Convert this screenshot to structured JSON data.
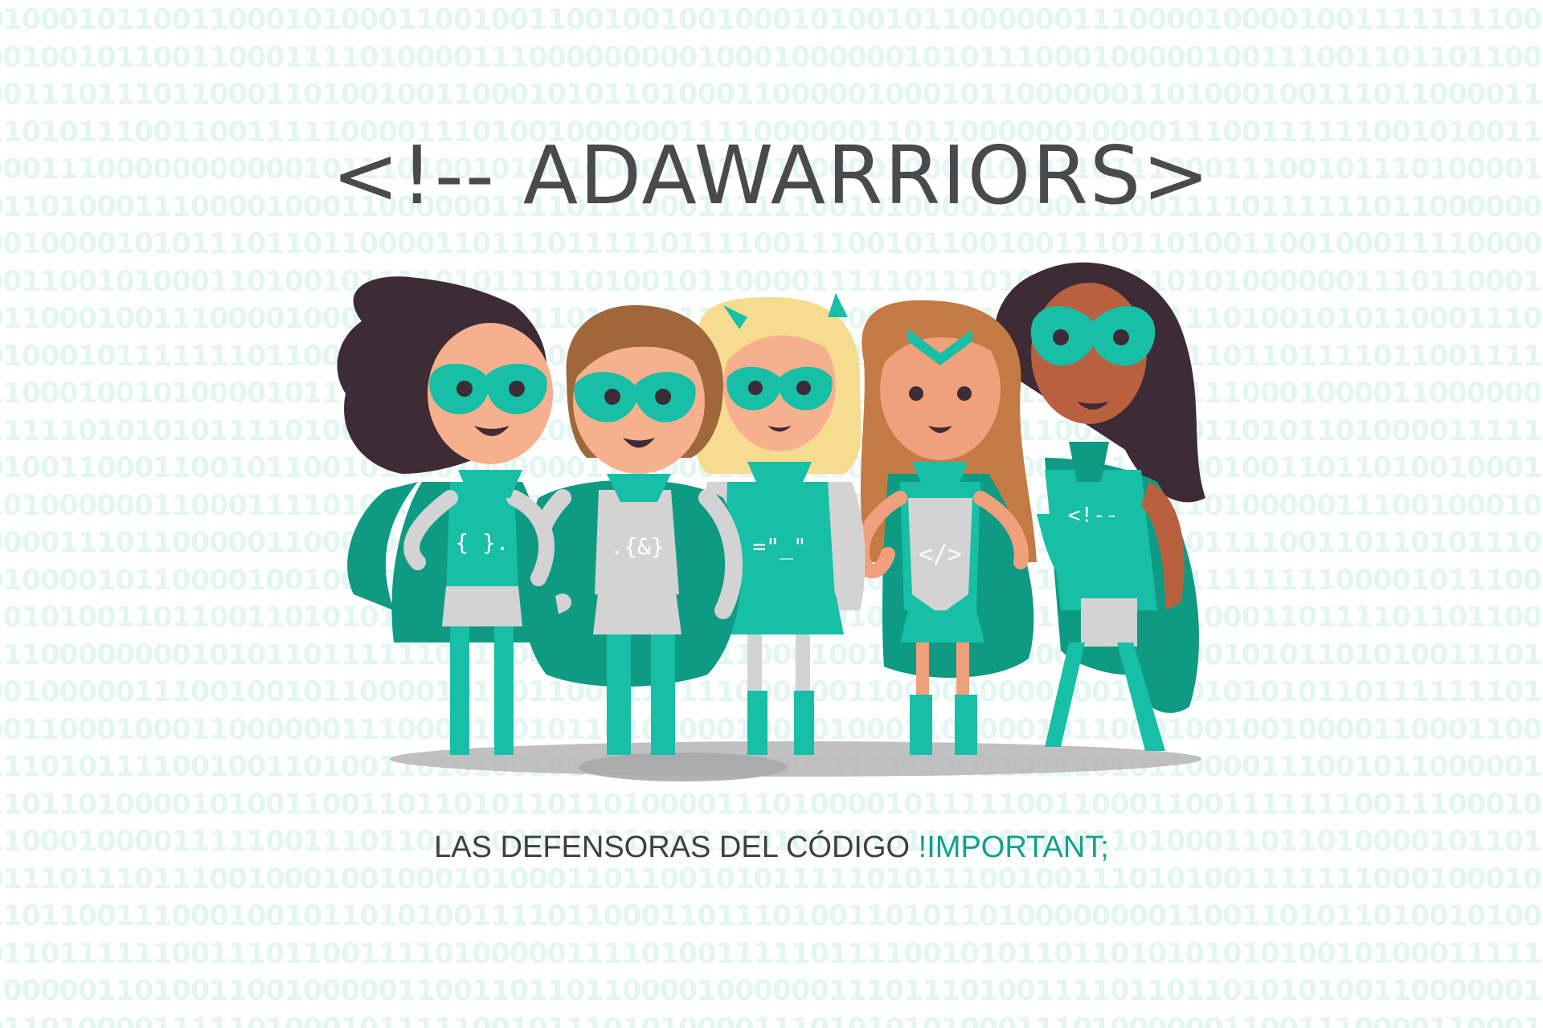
{
  "title": "<!-- ADAWARRIORS>",
  "tagline": {
    "main": "LAS DEFENSORAS DEL CÓDIGO ",
    "accent": "!IMPORTANT;"
  },
  "warriors": [
    {
      "name": "warrior-1",
      "chest_symbol": "{ }.",
      "hair": "#3d2b35",
      "skin": "#f7b08d"
    },
    {
      "name": "warrior-2",
      "chest_symbol": ".{&}",
      "hair": "#a0673a",
      "skin": "#f7b08d"
    },
    {
      "name": "warrior-3",
      "chest_symbol": "=\"_\"",
      "hair": "#f6dc8e",
      "skin": "#f7b08d"
    },
    {
      "name": "warrior-4",
      "chest_symbol": "</>",
      "hair": "#c47a44",
      "skin": "#f0a07c"
    },
    {
      "name": "warrior-5",
      "chest_symbol": "<!--",
      "hair": "#3d2b35",
      "skin": "#b9603e"
    }
  ],
  "colors": {
    "background": "#ffffff",
    "binary": "#e3f6f2",
    "title": "#4a4a4c",
    "tagline": "#3f3f41",
    "accent": "#13a08b",
    "teal": "#16bfa6",
    "teal_dark": "#0f9a83",
    "grey": "#d3d3d3",
    "shadow": "#b5b5b5"
  }
}
